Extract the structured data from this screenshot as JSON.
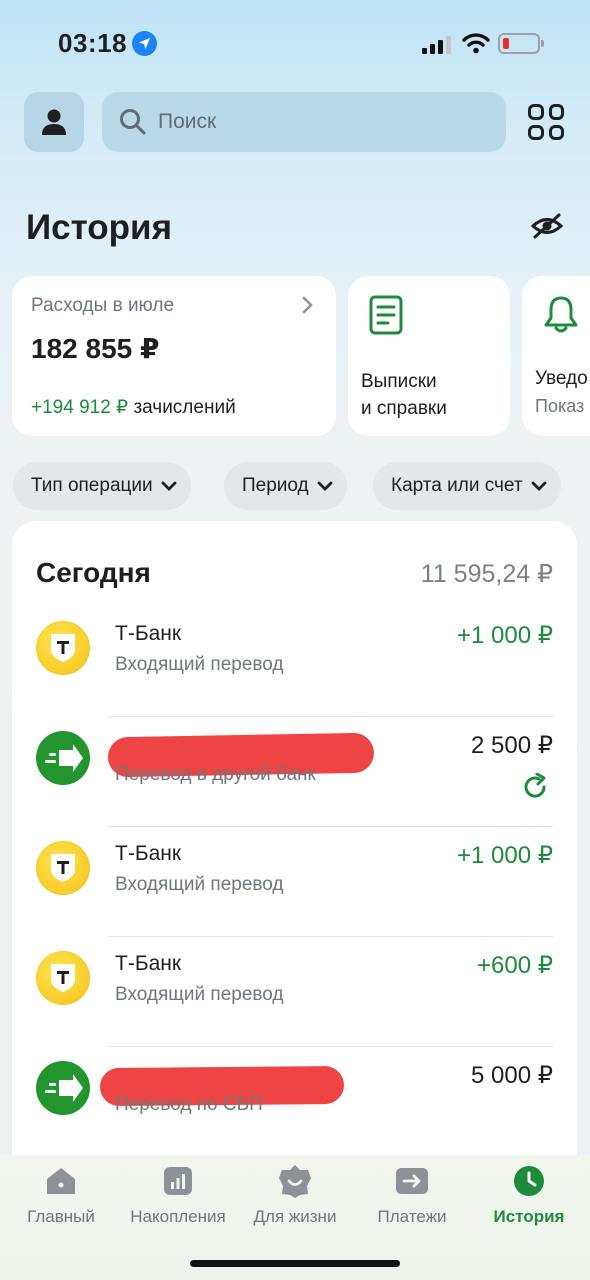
{
  "status_bar": {
    "time": "03:18"
  },
  "header": {
    "search_placeholder": "Поиск"
  },
  "page": {
    "title": "История"
  },
  "cards": {
    "expenses": {
      "label": "Расходы в июле",
      "amount": "182 855 ₽",
      "income_amount": "+194 912 ₽",
      "income_label": "зачислений"
    },
    "statements": {
      "line1": "Выписки",
      "line2": "и справки"
    },
    "notifications": {
      "label": "Уведо",
      "sub": "Показ"
    }
  },
  "filters": [
    {
      "label": "Тип операции"
    },
    {
      "label": "Период"
    },
    {
      "label": "Карта или счет"
    }
  ],
  "history": {
    "day_label": "Сегодня",
    "day_total": "11 595,24 ₽",
    "transactions": [
      {
        "name": "Т-Банк",
        "description": "Входящий перевод",
        "amount": "+1 000 ₽",
        "logo": "tbank-logo",
        "positive": true
      },
      {
        "name": "",
        "description": "Перевод в другой банк",
        "amount": "2 500 ₽",
        "logo": "transfer-arrow-icon",
        "positive": false,
        "redacted": true,
        "repeat_icon": "refresh-icon"
      },
      {
        "name": "Т-Банк",
        "description": "Входящий перевод",
        "amount": "+1 000 ₽",
        "logo": "tbank-logo",
        "positive": true
      },
      {
        "name": "Т-Банк",
        "description": "Входящий перевод",
        "amount": "+600 ₽",
        "logo": "tbank-logo",
        "positive": true
      },
      {
        "name": "",
        "description": "Перевод по СБП",
        "amount": "5 000 ₽",
        "logo": "transfer-arrow-icon",
        "positive": false,
        "redacted": true
      }
    ]
  },
  "bottom_nav": [
    {
      "label": "Главный",
      "icon": "home-icon",
      "active": false
    },
    {
      "label": "Накопления",
      "icon": "savings-chart-icon",
      "active": false
    },
    {
      "label": "Для жизни",
      "icon": "lifestyle-icon",
      "active": false
    },
    {
      "label": "Платежи",
      "icon": "payments-icon",
      "active": false
    },
    {
      "label": "История",
      "icon": "clock-icon",
      "active": true
    }
  ],
  "colors": {
    "accent_green": "#1e8a3c",
    "tbank_yellow": "#f4c21a",
    "transfer_green": "#22952f",
    "redaction_red": "#ee4444"
  }
}
